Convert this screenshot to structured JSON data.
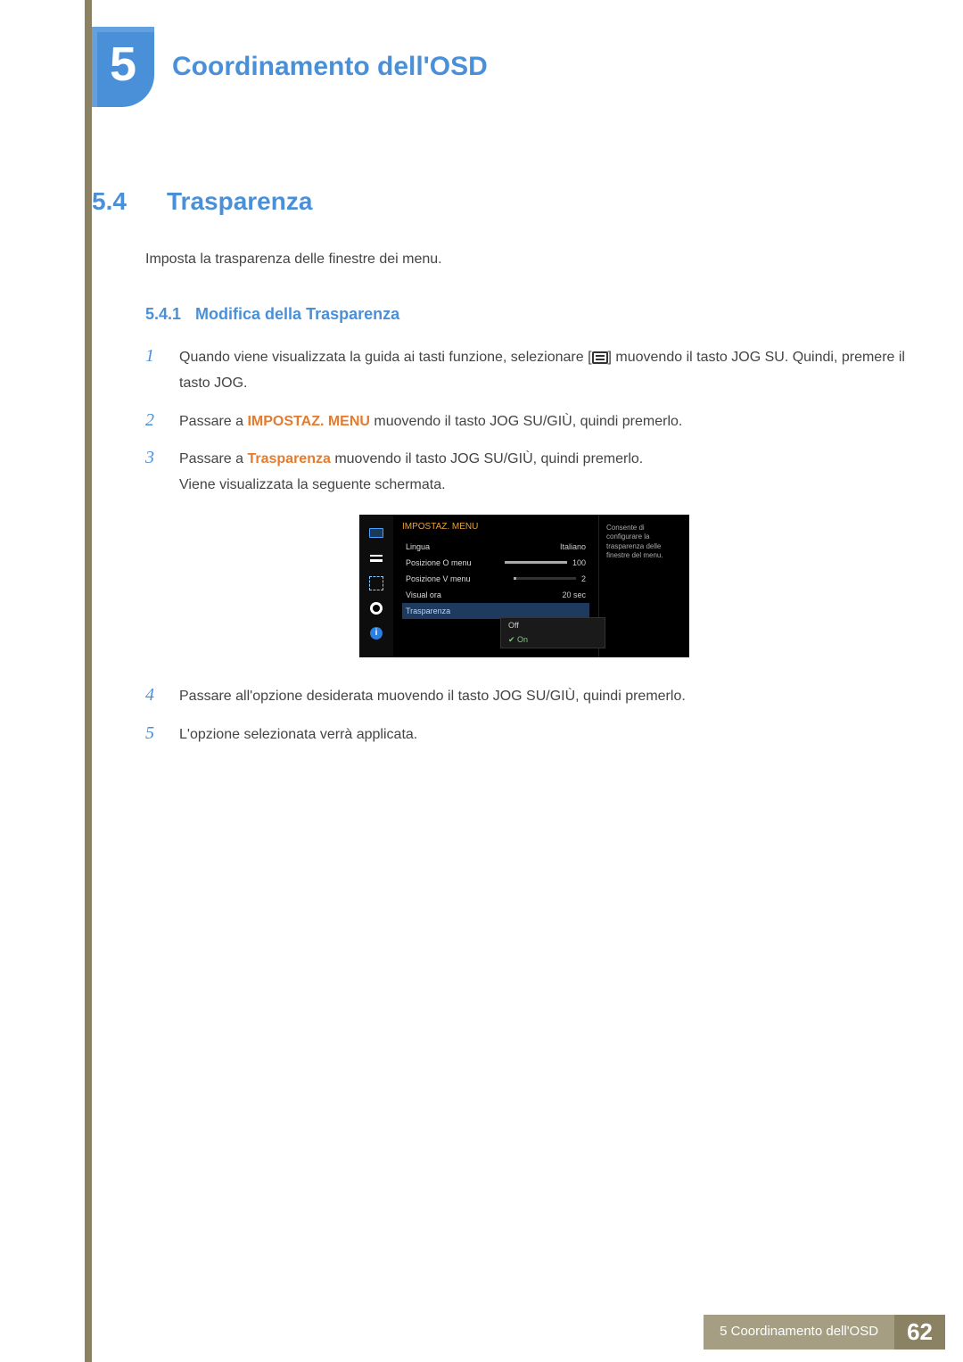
{
  "chapter": {
    "number": "5",
    "title": "Coordinamento dell'OSD"
  },
  "section": {
    "number": "5.4",
    "title": "Trasparenza"
  },
  "intro": "Imposta la trasparenza delle finestre dei menu.",
  "subsection": {
    "number": "5.4.1",
    "title": "Modifica della Trasparenza"
  },
  "steps": {
    "s1": {
      "num": "1",
      "pre": "Quando viene visualizzata la guida ai tasti funzione, selezionare [",
      "post": "] muovendo il tasto JOG SU. Quindi, premere il tasto JOG."
    },
    "s2": {
      "num": "2",
      "pre": "Passare a ",
      "bold": "IMPOSTAZ. MENU",
      "post": " muovendo il tasto JOG SU/GIÙ, quindi premerlo."
    },
    "s3": {
      "num": "3",
      "pre": "Passare a ",
      "bold": "Trasparenza",
      "post": " muovendo il tasto JOG SU/GIÙ, quindi premerlo.",
      "tail": "Viene visualizzata la seguente schermata."
    },
    "s4": {
      "num": "4",
      "text": "Passare all'opzione desiderata muovendo il tasto JOG SU/GIÙ, quindi premerlo."
    },
    "s5": {
      "num": "5",
      "text": "L'opzione selezionata verrà applicata."
    }
  },
  "osd": {
    "category": "IMPOSTAZ. MENU",
    "rows": {
      "lingua": {
        "label": "Lingua",
        "value": "Italiano"
      },
      "posO": {
        "label": "Posizione O menu",
        "value": "100",
        "barPct": 100
      },
      "posV": {
        "label": "Posizione V menu",
        "value": "2",
        "barPct": 4
      },
      "visual": {
        "label": "Visual ora",
        "value": "20 sec"
      },
      "trasp": {
        "label": "Trasparenza"
      }
    },
    "dropdown": {
      "off": "Off",
      "on": "On"
    },
    "help": "Consente di configurare la trasparenza delle finestre del menu."
  },
  "footer": {
    "label": "5 Coordinamento dell'OSD",
    "page": "62"
  }
}
